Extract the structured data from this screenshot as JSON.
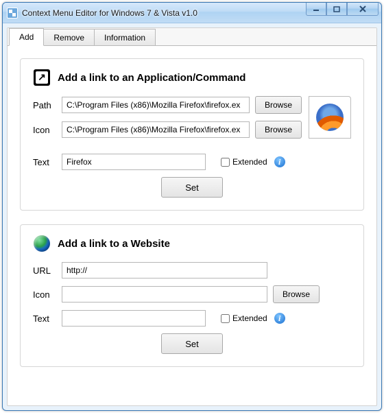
{
  "window": {
    "title": "Context Menu Editor for Windows 7 & Vista v1.0"
  },
  "tabs": [
    {
      "label": "Add",
      "active": true
    },
    {
      "label": "Remove",
      "active": false
    },
    {
      "label": "Information",
      "active": false
    }
  ],
  "app_section": {
    "title": "Add a link to an Application/Command",
    "path_label": "Path",
    "path_value": "C:\\Program Files (x86)\\Mozilla Firefox\\firefox.ex",
    "icon_label": "Icon",
    "icon_value": "C:\\Program Files (x86)\\Mozilla Firefox\\firefox.ex",
    "browse_label": "Browse",
    "text_label": "Text",
    "text_value": "Firefox",
    "extended_label": "Extended",
    "set_label": "Set"
  },
  "web_section": {
    "title": "Add a link to a Website",
    "url_label": "URL",
    "url_value": "http://",
    "icon_label": "Icon",
    "icon_value": "",
    "browse_label": "Browse",
    "text_label": "Text",
    "text_value": "",
    "extended_label": "Extended",
    "set_label": "Set"
  }
}
